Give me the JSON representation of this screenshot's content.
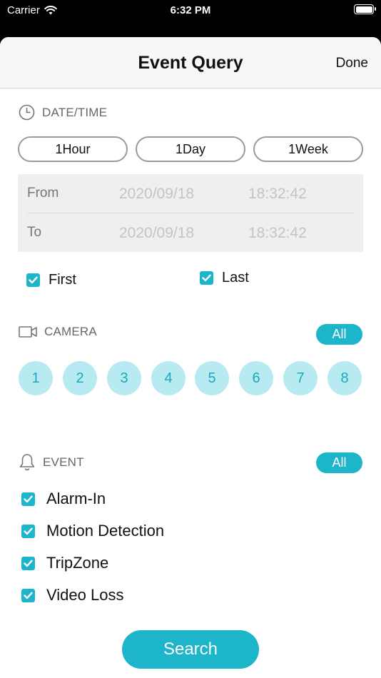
{
  "status_bar": {
    "carrier": "Carrier",
    "time": "6:32 PM"
  },
  "nav": {
    "title": "Event Query",
    "done_label": "Done"
  },
  "datetime": {
    "header": "DATE/TIME",
    "ranges": [
      "1Hour",
      "1Day",
      "1Week"
    ],
    "from_label": "From",
    "from_date": "2020/09/18",
    "from_time": "18:32:42",
    "to_label": "To",
    "to_date": "2020/09/18",
    "to_time": "18:32:42",
    "first_label": "First",
    "last_label": "Last"
  },
  "camera": {
    "header": "CAMERA",
    "all_label": "All",
    "channels": [
      "1",
      "2",
      "3",
      "4",
      "5",
      "6",
      "7",
      "8"
    ]
  },
  "event": {
    "header": "EVENT",
    "all_label": "All",
    "items": [
      "Alarm-In",
      "Motion Detection",
      "TripZone",
      "Video Loss"
    ]
  },
  "search_label": "Search",
  "colors": {
    "accent": "#1cb5c9",
    "camera_bg": "#b8eaf1",
    "camera_text": "#1ba8bd"
  },
  "icons": [
    "wifi-icon",
    "battery-icon",
    "clock-icon",
    "camera-icon",
    "bell-icon",
    "checkbox-checked-icon"
  ]
}
